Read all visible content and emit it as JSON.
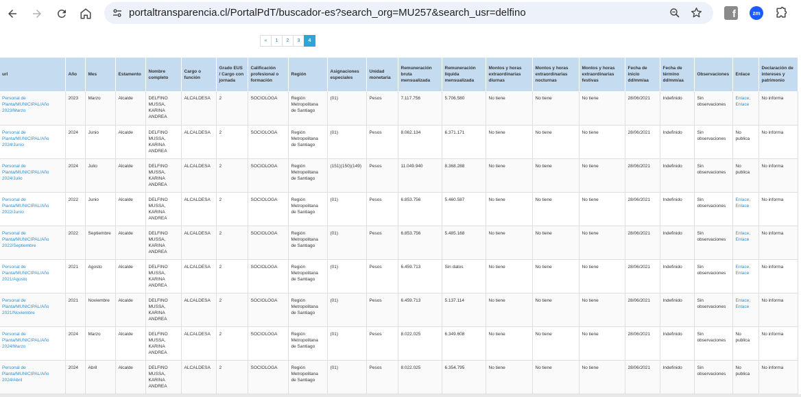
{
  "browser": {
    "url_host": "portaltransparencia.cl",
    "url_path": "/PortalPdT/buscador-es?search_org=MU257&search_usr=delfino",
    "ext_zm_label": "zm"
  },
  "pagination": {
    "prev": "«",
    "pages": [
      "1",
      "2",
      "3",
      "4"
    ],
    "active": "4"
  },
  "table": {
    "headers": {
      "url": "url",
      "anio": "Año",
      "mes": "Mes",
      "estamento": "Estamento",
      "nombre": "Nombre completo",
      "cargo": "Cargo o función",
      "grado": "Grado EUS / Cargo con jornada",
      "calificacion": "Calificación profesional o formación",
      "region": "Región",
      "asignaciones": "Asignaciones especiales",
      "unidad": "Unidad monetaria",
      "bruta": "Remuneración bruta mensualizada",
      "liquida": "Remuneración líquida mensualizada",
      "diurnas": "Montos y horas extraordinarias diurnas",
      "nocturnas": "Montos y horas extraordinarias nocturnas",
      "festivas": "Montos y horas extraordinarias festivas",
      "inicio": "Fecha de inicio dd/mm/aa",
      "termino": "Fecha de término dd/mm/aa",
      "observaciones": "Observaciones",
      "enlace": "Enlace",
      "declaracion": "Declaración de intereses y patrimonio"
    },
    "rows": [
      {
        "url": "Personal de Planta/MUNICIPAL/Año 2023/Marzo",
        "anio": "2023",
        "mes": "Marzo",
        "estamento": "Alcalde",
        "nombre": "DELFINO MUSSA, KARINA ANDREA",
        "cargo": "ALCALDESA",
        "grado": "2",
        "calificacion": "SOCIOLOGA",
        "region": "Región Metropolitana de Santiago",
        "asignaciones": "(01)",
        "unidad": "Pesos",
        "bruta": "7.117.756",
        "liquida": "5.706.580",
        "diurnas": "No tiene",
        "nocturnas": "No tiene",
        "festivas": "No tiene",
        "inicio": "28/06/2021",
        "termino": "Indefinido",
        "observaciones": "Sin observaciones",
        "enlace": "Enlace, Enlace",
        "declaracion": "No informa"
      },
      {
        "url": "Personal de Planta/MUNICIPAL/Año 2024/Junio",
        "anio": "2024",
        "mes": "Junio",
        "estamento": "Alcalde",
        "nombre": "DELFINO MUSSA, KARINA ANDREA",
        "cargo": "ALCALDESA",
        "grado": "2",
        "calificacion": "SOCIOLOGA",
        "region": "Región Metropolitana de Santiago",
        "asignaciones": "(01)",
        "unidad": "Pesos",
        "bruta": "8.062.134",
        "liquida": "6.371.171",
        "diurnas": "No tiene",
        "nocturnas": "No tiene",
        "festivas": "No tiene",
        "inicio": "28/06/2021",
        "termino": "Indefinido",
        "observaciones": "Sin observaciones",
        "enlace": "No publica",
        "declaracion": "No informa"
      },
      {
        "url": "Personal de Planta/MUNICIPAL/Año 2024/Julio",
        "anio": "2024",
        "mes": "Julio",
        "estamento": "Alcalde",
        "nombre": "DELFINO MUSSA, KARINA ANDREA",
        "cargo": "ALCALDESA",
        "grado": "2",
        "calificacion": "SOCIOLOGA",
        "region": "Región Metropolitana de Santiago",
        "asignaciones": "(151)(150)(149)",
        "unidad": "Pesos",
        "bruta": "11.049.940",
        "liquida": "8.368.288",
        "diurnas": "No tiene",
        "nocturnas": "No tiene",
        "festivas": "No tiene",
        "inicio": "28/06/2021",
        "termino": "Indefinido",
        "observaciones": "Sin observaciones",
        "enlace": "No publica",
        "declaracion": "No informa"
      },
      {
        "url": "Personal de Planta/MUNICIPAL/Año 2022/Junio",
        "anio": "2022",
        "mes": "Junio",
        "estamento": "Alcalde",
        "nombre": "DELFINO MUSSA, KARINA ANDREA",
        "cargo": "ALCALDESA",
        "grado": "2",
        "calificacion": "SOCIOLOGA",
        "region": "Región Metropolitana de Santiago",
        "asignaciones": "(01)",
        "unidad": "Pesos",
        "bruta": "6.853.756",
        "liquida": "5.460.587",
        "diurnas": "No tiene",
        "nocturnas": "No tiene",
        "festivas": "No tiene",
        "inicio": "28/06/2021",
        "termino": "Indefinido",
        "observaciones": "Sin observaciones",
        "enlace": "Enlace, Enlace",
        "declaracion": "No informa"
      },
      {
        "url": "Personal de Planta/MUNICIPAL/Año 2022/Septiembre",
        "anio": "2022",
        "mes": "Septiembre",
        "estamento": "Alcalde",
        "nombre": "DELFINO MUSSA, KARINA ANDREA",
        "cargo": "ALCALDESA",
        "grado": "2",
        "calificacion": "SOCIOLOGA",
        "region": "Región Metropolitana de Santiago",
        "asignaciones": "(01)",
        "unidad": "Pesos",
        "bruta": "6.853.756",
        "liquida": "5.485.168",
        "diurnas": "No tiene",
        "nocturnas": "No tiene",
        "festivas": "No tiene",
        "inicio": "28/06/2021",
        "termino": "Indefinido",
        "observaciones": "Sin observaciones",
        "enlace": "Enlace, Enlace",
        "declaracion": "No informa"
      },
      {
        "url": "Personal de Planta/MUNICIPAL/Año 2021/Agosto",
        "anio": "2021",
        "mes": "Agosto",
        "estamento": "Alcalde",
        "nombre": "DELFINO MUSSA, KARINA ANDREA",
        "cargo": "ALCALDESA",
        "grado": "2",
        "calificacion": "SOCIOLOGA",
        "region": "Región Metropolitana de Santiago",
        "asignaciones": "(01)",
        "unidad": "Pesos",
        "bruta": "6.459.713",
        "liquida": "Sin datos",
        "diurnas": "No tiene",
        "nocturnas": "No tiene",
        "festivas": "No tiene",
        "inicio": "28/06/2021",
        "termino": "Indefinido",
        "observaciones": "Sin observaciones",
        "enlace": "Enlace, Enlace",
        "declaracion": "No informa"
      },
      {
        "url": "Personal de Planta/MUNICIPAL/Año 2021/Noviembre",
        "anio": "2021",
        "mes": "Noviembre",
        "estamento": "Alcalde",
        "nombre": "DELFINO MUSSA, KARINA ANDREA",
        "cargo": "ALCALDESA",
        "grado": "2",
        "calificacion": "SOCIOLOGA",
        "region": "Región Metropolitana de Santiago",
        "asignaciones": "(01)",
        "unidad": "Pesos",
        "bruta": "6.459.713",
        "liquida": "5.137.114",
        "diurnas": "No tiene",
        "nocturnas": "No tiene",
        "festivas": "No tiene",
        "inicio": "28/06/2021",
        "termino": "Indefinido",
        "observaciones": "Sin observaciones",
        "enlace": "Enlace, Enlace",
        "declaracion": "No informa"
      },
      {
        "url": "Personal de Planta/MUNICIPAL/Año 2024/Marzo",
        "anio": "2024",
        "mes": "Marzo",
        "estamento": "Alcalde",
        "nombre": "DELFINO MUSSA, KARINA ANDREA",
        "cargo": "ALCALDESA",
        "grado": "2",
        "calificacion": "SOCIOLOGA",
        "region": "Región Metropolitana de Santiago",
        "asignaciones": "(01)",
        "unidad": "Pesos",
        "bruta": "8.022.025",
        "liquida": "6.349.608",
        "diurnas": "No tiene",
        "nocturnas": "No tiene",
        "festivas": "No tiene",
        "inicio": "28/06/2021",
        "termino": "Indefinido",
        "observaciones": "Sin observaciones",
        "enlace": "No publica",
        "declaracion": "No informa"
      },
      {
        "url": "Personal de Planta/MUNICIPAL/Año 2024/Abril",
        "anio": "2024",
        "mes": "Abril",
        "estamento": "Alcalde",
        "nombre": "DELFINO MUSSA, KARINA ANDREA",
        "cargo": "ALCALDESA",
        "grado": "2",
        "calificacion": "SOCIOLOGA",
        "region": "Región Metropolitana de Santiago",
        "asignaciones": "(01)",
        "unidad": "Pesos",
        "bruta": "8.022.025",
        "liquida": "6.354.795",
        "diurnas": "No tiene",
        "nocturnas": "No tiene",
        "festivas": "No tiene",
        "inicio": "28/06/2021",
        "termino": "Indefinido",
        "observaciones": "Sin observaciones",
        "enlace": "No publica",
        "declaracion": "No informa"
      }
    ]
  }
}
